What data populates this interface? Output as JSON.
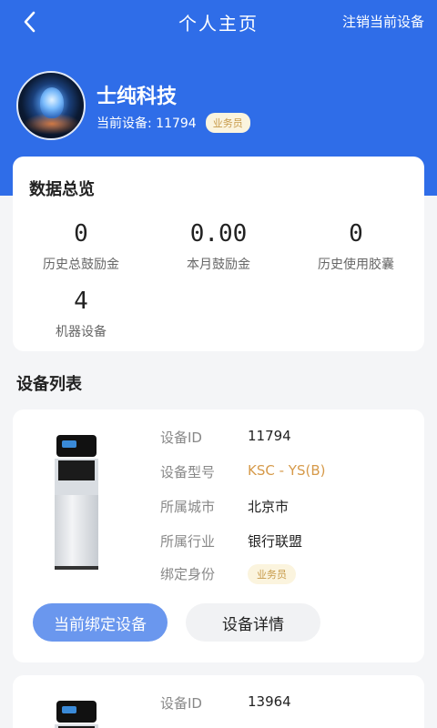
{
  "nav": {
    "title": "个人主页",
    "action": "注销当前设备"
  },
  "profile": {
    "name": "士纯科技",
    "current_device": "当前设备: 11794",
    "role_badge": "业务员"
  },
  "overview": {
    "title": "数据总览",
    "stats": [
      {
        "value": "0",
        "label": "历史总鼓励金"
      },
      {
        "value": "0.00",
        "label": "本月鼓励金"
      },
      {
        "value": "0",
        "label": "历史使用胶囊"
      },
      {
        "value": "4",
        "label": "机器设备"
      }
    ]
  },
  "device_list": {
    "title": "设备列表",
    "devices": [
      {
        "rows": [
          {
            "key": "设备ID",
            "value": "11794"
          },
          {
            "key": "设备型号",
            "value": "KSC - YS(B)"
          },
          {
            "key": "所属城市",
            "value": "北京市"
          },
          {
            "key": "所属行业",
            "value": "银行联盟"
          },
          {
            "key": "绑定身份",
            "value": "业务员"
          }
        ],
        "primary_button": "当前绑定设备",
        "secondary_button": "设备详情"
      },
      {
        "rows": [
          {
            "key": "设备ID",
            "value": "13964"
          }
        ]
      }
    ]
  },
  "colors": {
    "brand_blue": "#2f6de8",
    "button_blue": "#6a97ee",
    "model_orange": "#d69a4a",
    "badge_bg": "#fbf4de"
  }
}
